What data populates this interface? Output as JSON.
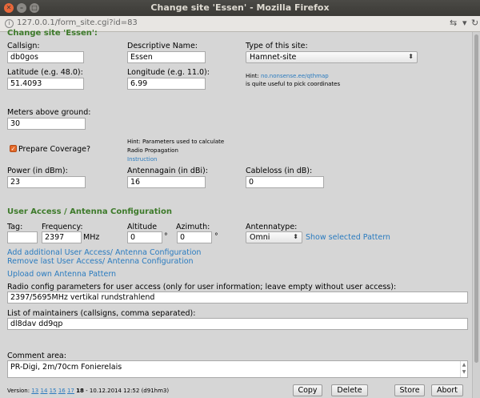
{
  "window": {
    "title": "Change site 'Essen' - Mozilla Firefox"
  },
  "browser": {
    "url": "127.0.0.1/form_site.cgi?id=83"
  },
  "page": {
    "section_title": "Change site 'Essen':",
    "callsign": {
      "label": "Callsign:",
      "value": "db0gos"
    },
    "descriptive_name": {
      "label": "Descriptive Name:",
      "value": "Essen"
    },
    "site_type": {
      "label": "Type of this site:",
      "value": "Hamnet-site"
    },
    "latitude": {
      "label": "Latitude (e.g. 48.0):",
      "value": "51.4093"
    },
    "longitude": {
      "label": "Longitude (e.g. 11.0):",
      "value": "6.99"
    },
    "coord_hint": {
      "prefix": "Hint:",
      "link": "no.nonsense.ee/qthmap",
      "suffix": "is quite useful to pick coordinates"
    },
    "meters_above_ground": {
      "label": "Meters above ground:",
      "value": "30"
    },
    "prepare_coverage": {
      "label": "Prepare Coverage?",
      "checked": true
    },
    "coverage_hint": {
      "line1": "Hint: Parameters used to calculate",
      "line2": "Radio Propagation",
      "link": "Instruction"
    },
    "power": {
      "label": "Power (in dBm):",
      "value": "23"
    },
    "antennagain": {
      "label": "Antennagain (in dBi):",
      "value": "16"
    },
    "cableloss": {
      "label": "Cableloss (in dB):",
      "value": "0"
    },
    "user_access_heading": "User Access / Antenna Configuration",
    "ua": {
      "tag_label": "Tag:",
      "tag_value": "",
      "frequency_label": "Frequency:",
      "frequency_value": "2397",
      "frequency_unit": "MHz",
      "altitude_label": "Altitude",
      "altitude_value": "0",
      "altitude_unit": "°",
      "azimuth_label": "Azimuth:",
      "azimuth_value": "0",
      "azimuth_unit": "°",
      "antennatype_label": "Antennatype:",
      "antennatype_value": "Omni",
      "show_pattern_link": "Show selected Pattern"
    },
    "links": {
      "add_ua": "Add additional User Access/ Antenna Configuration",
      "remove_ua": "Remove last User Access/ Antenna Configuration",
      "upload_antenna": "Upload own Antenna Pattern"
    },
    "radio_config": {
      "label": "Radio config parameters for user access (only for user information; leave empty without user access):",
      "value": "2397/5695MHz vertikal rundstrahlend"
    },
    "maintainers": {
      "label": "List of maintainers (callsigns, comma separated):",
      "value": "dl8dav dd9qp"
    },
    "comment": {
      "label": "Comment area:",
      "value": "PR-Digi, 2m/70cm Fonierelais"
    }
  },
  "footer": {
    "version_prefix": "Version:",
    "versions": [
      "13",
      "14",
      "15",
      "16",
      "17"
    ],
    "current_version": "18",
    "version_info": "- 10.12.2014 12:52 (d91hm3)",
    "buttons": {
      "copy": "Copy",
      "delete": "Delete",
      "store": "Store",
      "abort": "Abort"
    }
  },
  "colors": {
    "heading": "#3d7a2a",
    "link": "#2a7bbf",
    "checkbox": "#e46a2a"
  }
}
